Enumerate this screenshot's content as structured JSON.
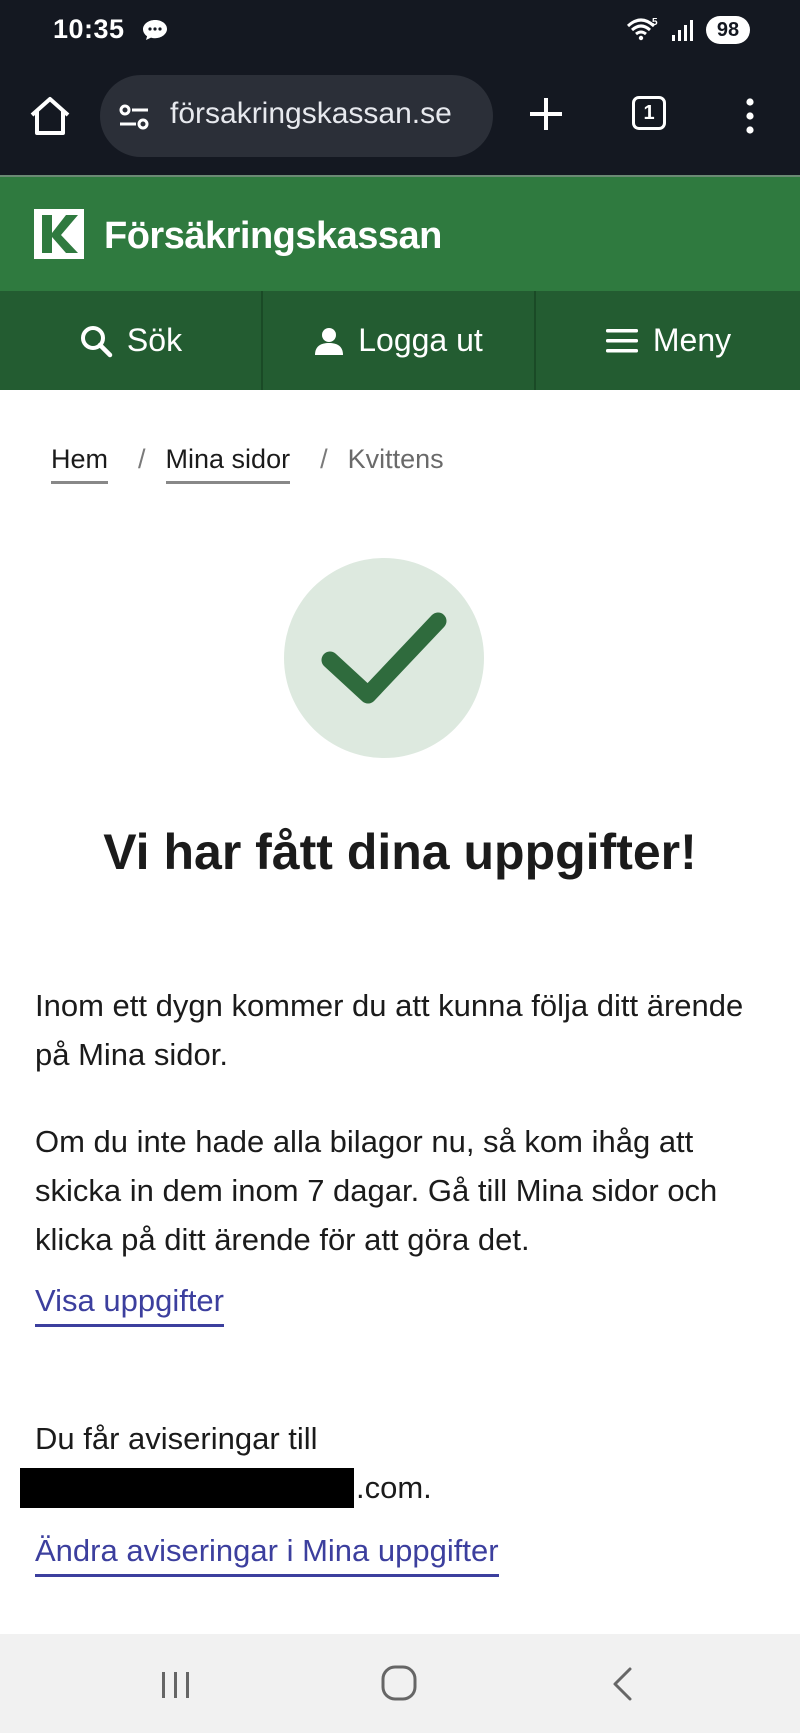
{
  "status_bar": {
    "time": "10:35",
    "battery": "98"
  },
  "browser": {
    "url": "försakringskassan.se",
    "tab_count": "1"
  },
  "site": {
    "logo_text": "Försäkringskassan",
    "brand_color": "#2f7a3f",
    "nav": {
      "search_label": "Sök",
      "logout_label": "Logga ut",
      "menu_label": "Meny"
    }
  },
  "breadcrumb": {
    "items": [
      "Hem",
      "Mina sidor"
    ],
    "current": "Kvittens",
    "separator": "/"
  },
  "receipt": {
    "icon": "checkmark-icon",
    "heading": "Vi har fått dina uppgifter!",
    "para1": "Inom ett dygn kommer du att kunna följa ditt ärende på Mina sidor.",
    "para2": "Om du inte hade alla bilagor nu, så kom ihåg att skicka in dem inom 7 dagar. Gå till Mina sidor och klicka på ditt ärende för att göra det.",
    "link_show": "Visa uppgifter",
    "notify_text": "Du får aviseringar till",
    "email_suffix": ".com.",
    "link_change": "Ändra aviseringar i Mina uppgifter"
  }
}
